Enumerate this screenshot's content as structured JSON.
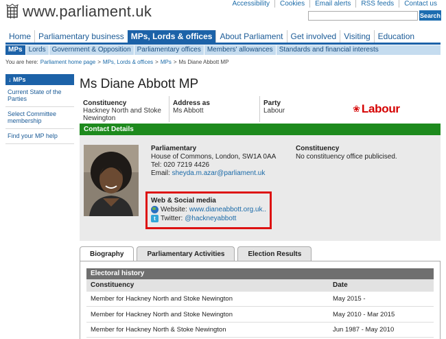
{
  "header": {
    "logo_text": "www.parliament.uk",
    "utility_links": [
      "Accessibility",
      "Cookies",
      "Email alerts",
      "RSS feeds",
      "Contact us"
    ],
    "search_value": "",
    "search_button": "Search"
  },
  "main_nav": [
    {
      "label": "Home",
      "active": false
    },
    {
      "label": "Parliamentary business",
      "active": false
    },
    {
      "label": "MPs, Lords & offices",
      "active": true
    },
    {
      "label": "About Parliament",
      "active": false
    },
    {
      "label": "Get involved",
      "active": false
    },
    {
      "label": "Visiting",
      "active": false
    },
    {
      "label": "Education",
      "active": false
    }
  ],
  "sub_nav": [
    {
      "label": "MPs",
      "active": true
    },
    {
      "label": "Lords",
      "active": false
    },
    {
      "label": "Government & Opposition",
      "active": false
    },
    {
      "label": "Parliamentary offices",
      "active": false
    },
    {
      "label": "Members' allowances",
      "active": false
    },
    {
      "label": "Standards and financial interests",
      "active": false
    }
  ],
  "breadcrumb": {
    "prefix": "You are here:",
    "links": [
      "Parliament home page",
      "MPs, Lords & offices",
      "MPs"
    ],
    "separator": ">",
    "current": "Ms Diane Abbott MP"
  },
  "sidebar": {
    "heading": "MPs",
    "heading_icon": "down-arrow-icon",
    "items": [
      "Current State of the Parties",
      "Select Committee membership",
      "Find your MP help"
    ]
  },
  "profile": {
    "title": "Ms Diane Abbott MP",
    "constituency_label": "Constituency",
    "constituency_value": "Hackney North and Stoke Newington",
    "address_label": "Address as",
    "address_value": "Ms Abbott",
    "party_label": "Party",
    "party_value": "Labour",
    "party_logo_text": "Labour",
    "party_color": "#d50000"
  },
  "contact": {
    "bar_title": "Contact Details",
    "bar_color": "#1d8a1d",
    "parliamentary_head": "Parliamentary",
    "parliamentary_address": "House of Commons, London, SW1A 0AA",
    "tel": "Tel: 020 7219 4426",
    "email_label": "Email:",
    "email_value": "sheyda.m.azar@parliament.uk",
    "constituency_head": "Constituency",
    "constituency_text": "No constituency office publicised.",
    "web_head": "Web & Social media",
    "website_label": "Website:",
    "website_value": "www.dianeabbott.org.uk..",
    "twitter_label": "Twitter:",
    "twitter_value": "@hackneyabbott",
    "highlight_color": "#dd1111"
  },
  "tabs": [
    {
      "label": "Biography",
      "active": true
    },
    {
      "label": "Parliamentary Activities",
      "active": false
    },
    {
      "label": "Election Results",
      "active": false
    }
  ],
  "electoral_history": {
    "heading": "Electoral history",
    "col_constituency": "Constituency",
    "col_date": "Date",
    "rows": [
      {
        "constituency": "Member for Hackney North and Stoke Newington",
        "date": "May 2015 -"
      },
      {
        "constituency": "Member for Hackney North and Stoke Newington",
        "date": "May 2010 - Mar 2015"
      },
      {
        "constituency": "Member for Hackney North & Stoke Newington",
        "date": "Jun 1987 - May 2010"
      }
    ]
  }
}
